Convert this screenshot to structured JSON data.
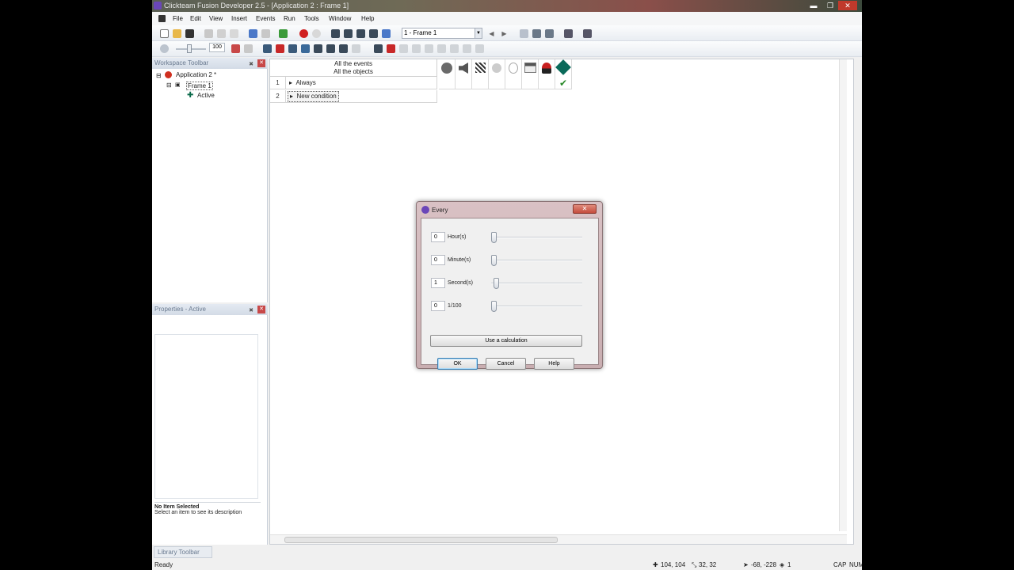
{
  "window": {
    "title": "Clickteam Fusion Developer 2.5 - [Application 2 : Frame 1]",
    "minimize": "▬",
    "maximize": "❐",
    "close": "✕"
  },
  "menu": [
    "File",
    "Edit",
    "View",
    "Insert",
    "Events",
    "Run",
    "Tools",
    "Window",
    "Help"
  ],
  "toolbar": {
    "frame_select": "1 - Frame 1",
    "zoom_value": "100"
  },
  "workspace": {
    "header": "Workspace Toolbar",
    "tree": {
      "application": "Application 2 *",
      "frame": "Frame 1",
      "object": "Active"
    }
  },
  "properties": {
    "header": "Properties - Active",
    "desc_title": "No Item Selected",
    "desc_text": "Select an item to see its description"
  },
  "event_editor": {
    "header_line1": "All the events",
    "header_line2": "All the objects",
    "rows": [
      {
        "num": "1",
        "label": "Always"
      },
      {
        "num": "2",
        "label": "New condition"
      }
    ],
    "checkmark": "✔"
  },
  "dialog": {
    "title": "Every",
    "close": "✕",
    "fields": [
      {
        "value": "0",
        "label": "Hour(s)",
        "level": 0.0
      },
      {
        "value": "0",
        "label": "Minute(s)",
        "level": 0.0
      },
      {
        "value": "1",
        "label": "Second(s)",
        "level": 0.01
      },
      {
        "value": "0",
        "label": "1/100",
        "level": 0.0
      }
    ],
    "calc_button": "Use a calculation",
    "ok": "OK",
    "cancel": "Cancel",
    "help": "Help"
  },
  "library_tab": "Library Toolbar",
  "status": {
    "ready": "Ready",
    "coord1": "104, 104",
    "coord2": "32, 32",
    "coord3": "-68, -228",
    "coord4": "1",
    "caps": "CAP",
    "num": "NUM"
  }
}
